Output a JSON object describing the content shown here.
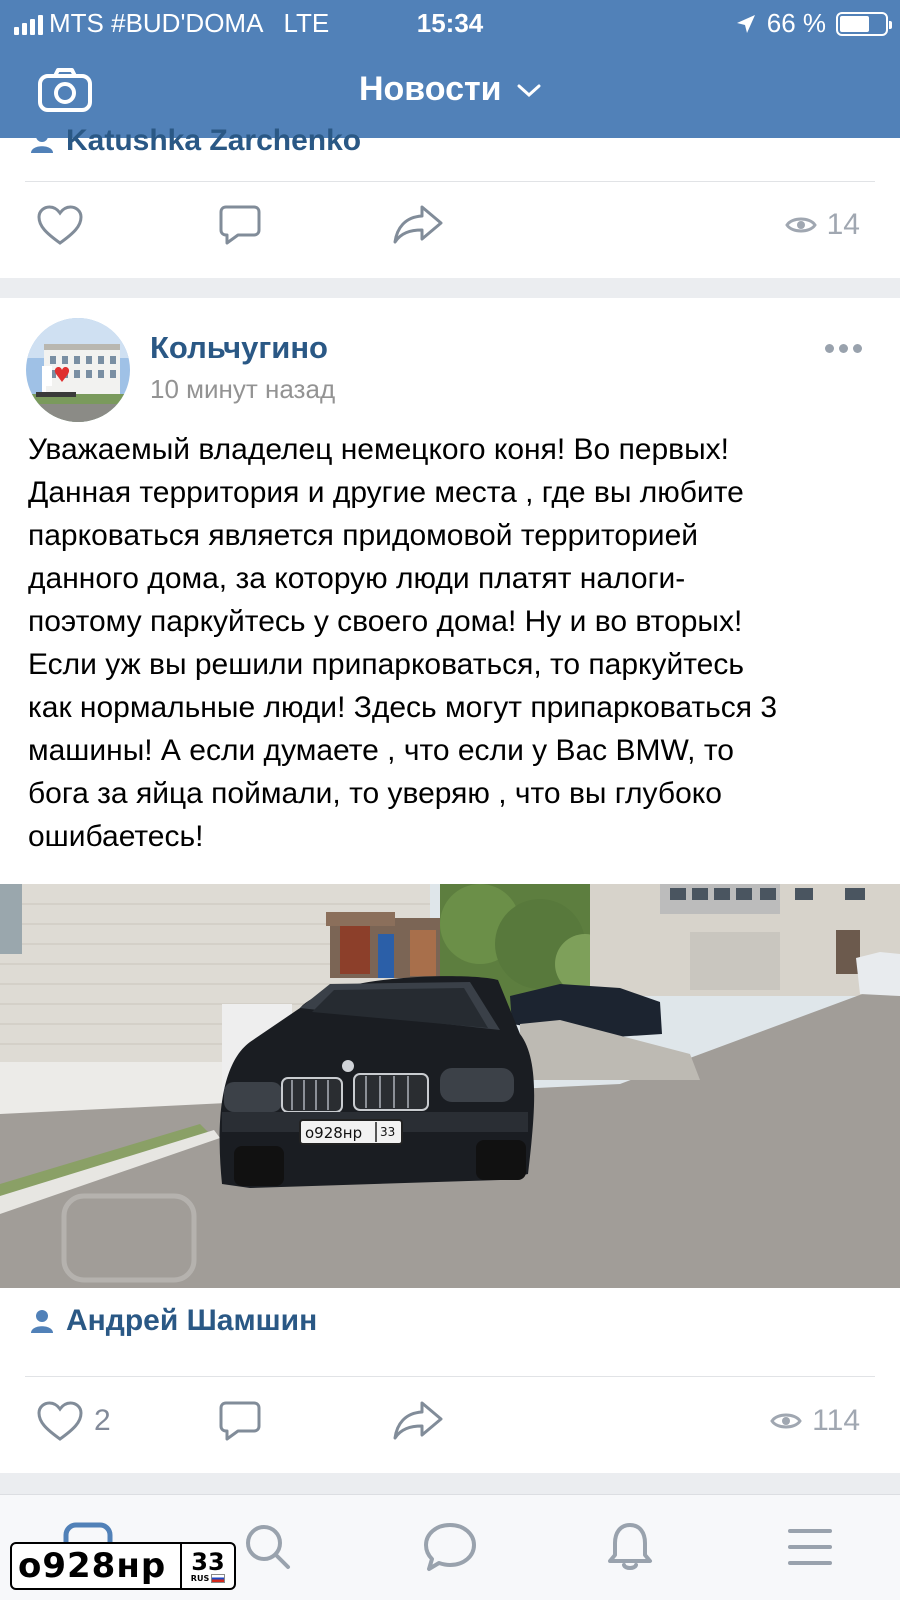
{
  "status_bar": {
    "carrier": "MTS #BUD'DOMA",
    "network": "LTE",
    "time": "15:34",
    "battery": "66 %",
    "battery_level": 0.66
  },
  "header": {
    "title": "Новости"
  },
  "previous_post": {
    "author": "Katushka Zarchenko",
    "views": "14"
  },
  "post": {
    "group_name": "Кольчугино",
    "time": "10 минут назад",
    "text": "Уважаемый владелец немецкого коня! Во первых!\nДанная территория и другие места , где вы любите\nпарковаться   является придомовой территорией\nданного дома, за которую люди платят налоги-\nпоэтому паркуйтесь у своего дома! Ну и во вторых!\nЕсли уж вы решили припарковаться, то паркуйтесь\nкак нормальные люди! Здесь могут припарковаться 3\nмашины! А если думаете , что если у Вас BMW, то\nбога за яйца поймали, то уверяю , что вы глубоко\nошибаетесь!",
    "photo_plate": "о928нр",
    "photo_plate_region": "33",
    "author": "Андрей Шамшин",
    "likes": "2",
    "views": "114"
  },
  "overlay_plate": {
    "number": "о928нр",
    "region": "33",
    "country": "RUS"
  },
  "colors": {
    "header": "#5181b8",
    "link": "#2a5885",
    "icon": "#818c99"
  },
  "icons": [
    "camera-icon",
    "chevron-down-icon",
    "like-icon",
    "comment-icon",
    "share-icon",
    "eye-icon",
    "more-icon",
    "user-icon",
    "news-tab-icon",
    "search-tab-icon",
    "messages-tab-icon",
    "notifications-tab-icon",
    "menu-tab-icon"
  ]
}
